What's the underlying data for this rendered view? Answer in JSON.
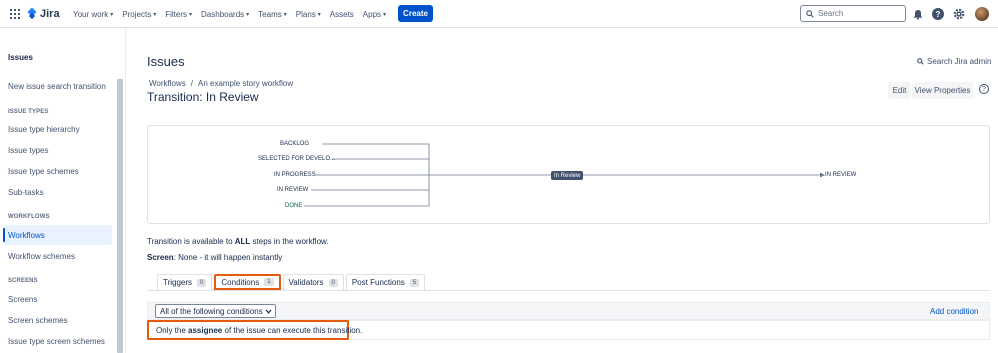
{
  "topnav": {
    "logo_text": "Jira",
    "items": [
      "Your work",
      "Projects",
      "Filters",
      "Dashboards",
      "Teams",
      "Plans",
      "Assets",
      "Apps"
    ],
    "create_label": "Create",
    "search_placeholder": "Search",
    "help_glyph": "?"
  },
  "sidebar": {
    "title": "Issues",
    "item_new_search_transition": "New issue search transition",
    "head_issue_types": "Issue types",
    "item_issue_type_hierarchy": "Issue type hierarchy",
    "item_issue_types": "Issue types",
    "item_issue_type_schemes": "Issue type schemes",
    "item_subtasks": "Sub-tasks",
    "head_workflows": "Workflows",
    "item_workflows": "Workflows",
    "item_workflow_schemes": "Workflow schemes",
    "head_screens": "Screens",
    "item_screens": "Screens",
    "item_screen_schemes": "Screen schemes",
    "item_issue_type_screen_schemes": "Issue type screen schemes"
  },
  "main": {
    "title": "Issues",
    "search_admin": "Search Jira admin",
    "breadcrumb": [
      "Workflows",
      "/",
      "An example story workflow"
    ],
    "page_title": "Transition: In Review",
    "edit_label": "Edit",
    "view_properties_label": "View Properties",
    "help_glyph": "?"
  },
  "diagram": {
    "steps": [
      "BACKLOG",
      "SELECTED FOR DEVELO...",
      "IN PROGRESS",
      "IN REVIEW",
      "DONE"
    ],
    "transition_label": "In Review",
    "target_step": "IN REVIEW"
  },
  "notes": {
    "available_prefix": "Transition is available to ",
    "available_bold": "ALL",
    "available_suffix": " steps in the workflow.",
    "screen_label": "Screen",
    "screen_value": ": None - it will happen instantly"
  },
  "tabs": [
    {
      "label": "Triggers",
      "count": "0"
    },
    {
      "label": "Conditions",
      "count": "1"
    },
    {
      "label": "Validators",
      "count": "0"
    },
    {
      "label": "Post Functions",
      "count": "5"
    }
  ],
  "conditions": {
    "select_value": "All of the following conditions",
    "add_label": "Add condition",
    "rule_prefix": "Only the ",
    "rule_bold": "assignee",
    "rule_suffix": " of the issue can execute this transition."
  },
  "colors": {
    "primary": "#0052cc",
    "highlight": "#e35b0e",
    "done_green": "#006644"
  }
}
